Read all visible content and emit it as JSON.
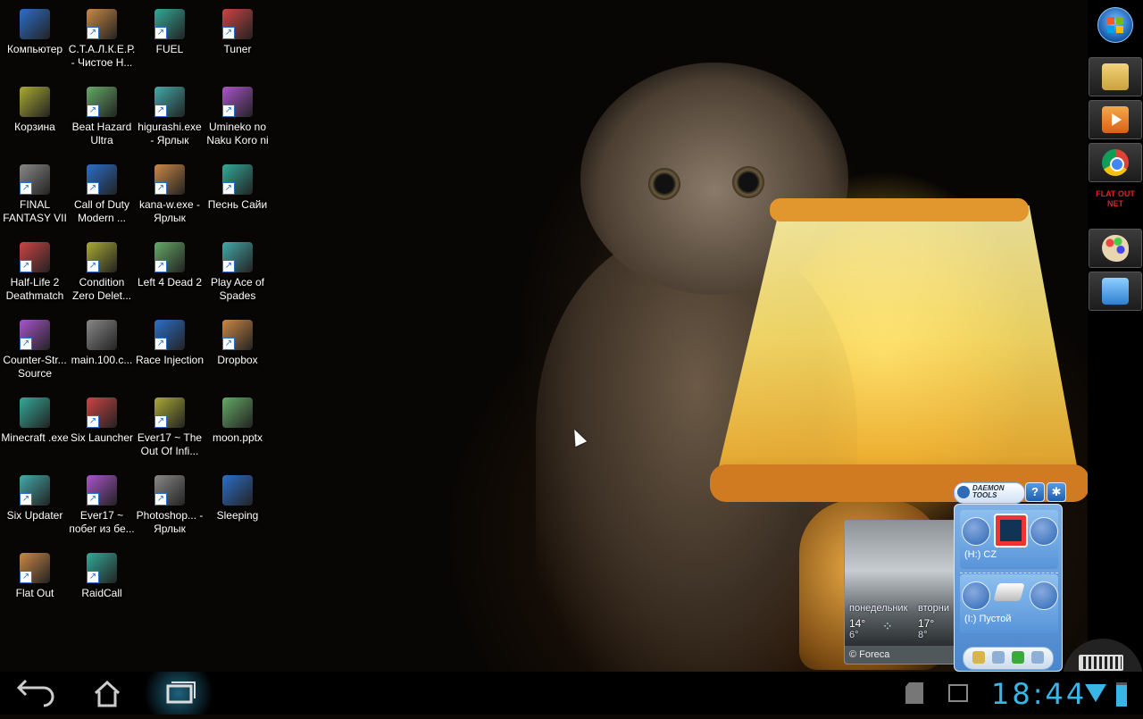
{
  "desktop": {
    "icons": [
      {
        "label": "Компьютер",
        "icon": "computer-icon",
        "shortcut": false
      },
      {
        "label": "С.Т.А.Л.К.Е.Р. - Чистое Н...",
        "icon": "stalker-icon",
        "shortcut": true
      },
      {
        "label": "FUEL",
        "icon": "fuel-icon",
        "shortcut": true
      },
      {
        "label": "Tuner",
        "icon": "tuner-icon",
        "shortcut": true
      },
      {
        "label": "Корзина",
        "icon": "recycle-bin-icon",
        "shortcut": false
      },
      {
        "label": "Beat Hazard Ultra",
        "icon": "beat-hazard-icon",
        "shortcut": true
      },
      {
        "label": "higurashi.exe - Ярлык",
        "icon": "higurashi-icon",
        "shortcut": true
      },
      {
        "label": "Umineko no Naku Koro ni",
        "icon": "umineko-icon",
        "shortcut": true
      },
      {
        "label": "FINAL FANTASY VII",
        "icon": "final-fantasy-icon",
        "shortcut": true
      },
      {
        "label": "Call of Duty Modern ...",
        "icon": "call-of-duty-icon",
        "shortcut": true
      },
      {
        "label": "kana-w.exe - Ярлык",
        "icon": "kana-icon",
        "shortcut": true
      },
      {
        "label": "Песнь Сайи",
        "icon": "saya-icon",
        "shortcut": true
      },
      {
        "label": "Half-Life 2 Deathmatch",
        "icon": "half-life-icon",
        "shortcut": true
      },
      {
        "label": "Condition Zero Delet...",
        "icon": "condition-zero-icon",
        "shortcut": true
      },
      {
        "label": "Left 4 Dead 2",
        "icon": "left4dead-icon",
        "shortcut": true
      },
      {
        "label": "Play Ace of Spades",
        "icon": "chrome-icon",
        "shortcut": true
      },
      {
        "label": "Counter-Str... Source",
        "icon": "counter-strike-icon",
        "shortcut": true
      },
      {
        "label": "main.100.c...",
        "icon": "archive-icon",
        "shortcut": false
      },
      {
        "label": "Race Injection",
        "icon": "race-injection-icon",
        "shortcut": true
      },
      {
        "label": "Dropbox",
        "icon": "dropbox-icon",
        "shortcut": true
      },
      {
        "label": "Minecraft .exe",
        "icon": "minecraft-icon",
        "shortcut": false
      },
      {
        "label": "Six Launcher",
        "icon": "six-launcher-icon",
        "shortcut": true
      },
      {
        "label": "Ever17 ~ The Out Of Infi...",
        "icon": "ever17-icon",
        "shortcut": true
      },
      {
        "label": "moon.pptx",
        "icon": "pptx-icon",
        "shortcut": false
      },
      {
        "label": "Six Updater",
        "icon": "six-updater-icon",
        "shortcut": true
      },
      {
        "label": "Ever17 ~ побег из бе...",
        "icon": "ever17-icon",
        "shortcut": true
      },
      {
        "label": "Photoshop... - Ярлык",
        "icon": "photoshop-icon",
        "shortcut": true
      },
      {
        "label": "Sleeping",
        "icon": "sleeping-dogs-icon",
        "shortcut": false
      },
      {
        "label": "Flat Out",
        "icon": "utorrent-icon",
        "shortcut": true
      },
      {
        "label": "RaidCall",
        "icon": "raidcall-icon",
        "shortcut": true
      }
    ]
  },
  "sidebar": {
    "items": [
      {
        "name": "start-orb",
        "icon": "windows-orb-icon"
      },
      {
        "name": "explorer",
        "icon": "folder-icon"
      },
      {
        "name": "media-player",
        "icon": "media-player-icon"
      },
      {
        "name": "chrome",
        "icon": "chrome-icon"
      },
      {
        "name": "flatout",
        "icon": "flatout-net-icon",
        "text": "FLAT OUT NET"
      },
      {
        "name": "paint",
        "icon": "palette-icon"
      },
      {
        "name": "control-panel",
        "icon": "control-panel-icon"
      }
    ]
  },
  "weather": {
    "days": [
      "понедельник",
      "вторни"
    ],
    "highs": [
      "14°",
      "17°"
    ],
    "lows": [
      "6°",
      "8°"
    ],
    "credit": "© Foreca"
  },
  "daemon": {
    "title": "DAEMON TOOLS",
    "drives": [
      {
        "label": "(H:) CZ"
      },
      {
        "label": "(I:) Пустой"
      }
    ]
  },
  "taskbar": {
    "time": "18:44",
    "buttons": [
      "back-icon",
      "home-icon",
      "recent-apps-icon"
    ],
    "tray": [
      "sd-card-icon",
      "gallery-icon",
      "wifi-icon",
      "battery-icon"
    ]
  },
  "colors": {
    "clock": "#39b5e6",
    "daemon_blue": "#4a86cc"
  }
}
